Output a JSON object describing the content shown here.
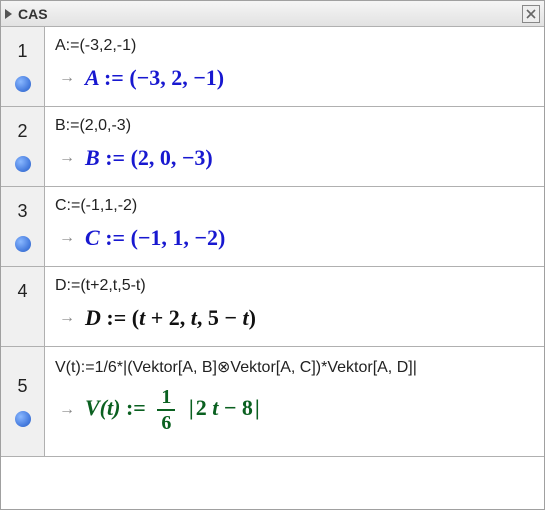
{
  "titlebar": {
    "title": "CAS"
  },
  "rows": [
    {
      "num": "1",
      "has_bullet": true,
      "input": "A:=(-3,2,-1)",
      "out_color": "blue",
      "out_lhs": "A",
      "out_rhs": "(−3, 2, −1)"
    },
    {
      "num": "2",
      "has_bullet": true,
      "input": "B:=(2,0,-3)",
      "out_color": "blue",
      "out_lhs": "B",
      "out_rhs": "(2, 0, −3)"
    },
    {
      "num": "3",
      "has_bullet": true,
      "input": "C:=(-1,1,-2)",
      "out_color": "blue",
      "out_lhs": "C",
      "out_rhs": "(−1, 1, −2)"
    },
    {
      "num": "4",
      "has_bullet": false,
      "input": "D:=(t+2,t,5-t)",
      "out_color": "black",
      "out_lhs": "D",
      "out_rhs": "(t + 2, t, 5 − t)"
    },
    {
      "num": "5",
      "has_bullet": true,
      "input": "V(t):=1/6*|(Vektor[A, B]⊗Vektor[A, C])*Vektor[A, D]|",
      "out_color": "green",
      "out_lhs": "V(t)",
      "frac_num": "1",
      "frac_den": "6",
      "abs_inner": "2 t − 8"
    }
  ]
}
